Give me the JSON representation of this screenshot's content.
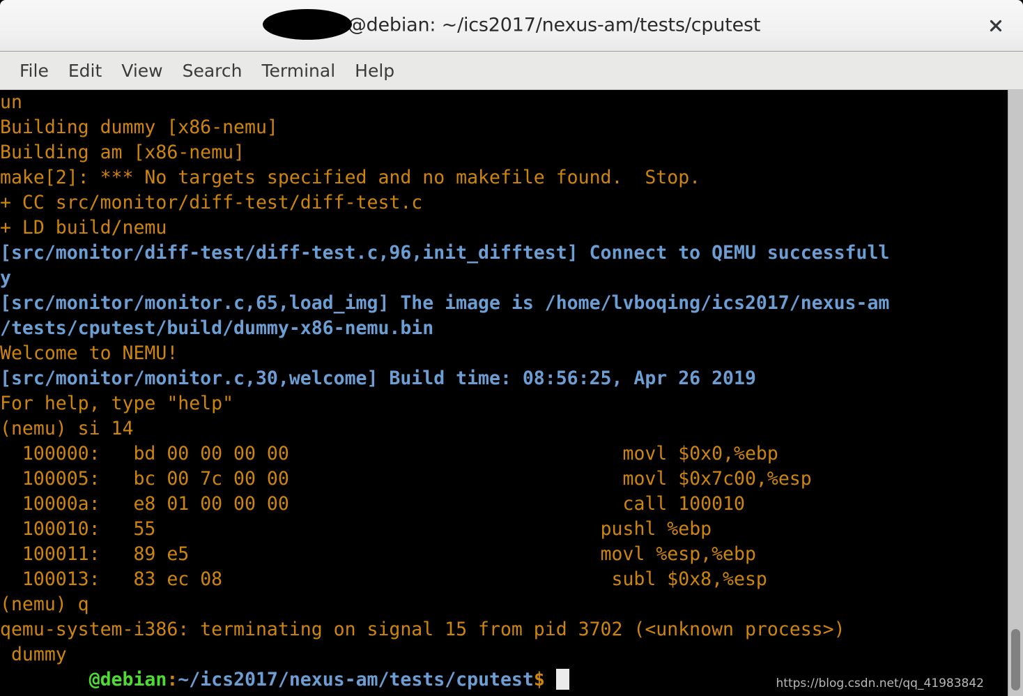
{
  "window": {
    "title": "@debian: ~/ics2017/nexus-am/tests/cputest",
    "close_label": "✕"
  },
  "menubar": {
    "items": [
      {
        "label": "File"
      },
      {
        "label": "Edit"
      },
      {
        "label": "View"
      },
      {
        "label": "Search"
      },
      {
        "label": "Terminal"
      },
      {
        "label": "Help"
      }
    ]
  },
  "colors": {
    "background": "#000000",
    "orange": "#cd850b",
    "blue": "#6c9ed4",
    "green": "#4fdb33",
    "titlebar": "#f2f2f2",
    "menubar": "#e9e9e7",
    "scrollbar_track": "#c6c6c6",
    "scrollbar_thumb": "#818181",
    "cursor": "#ebebeb"
  },
  "terminal": {
    "lines": [
      "un",
      "Building dummy [x86-nemu]",
      "Building am [x86-nemu]",
      "make[2]: *** No targets specified and no makefile found.  Stop.",
      "+ CC src/monitor/diff-test/diff-test.c",
      "+ LD build/nemu"
    ],
    "log_line_1": "[src/monitor/diff-test/diff-test.c,96,init_difftest] Connect to QEMU successfull",
    "log_line_1_wrap": "y",
    "log_line_2": "[src/monitor/monitor.c,65,load_img] The image is /home/lvboqing/ics2017/nexus-am",
    "log_line_2_wrap": "/tests/cputest/build/dummy-x86-nemu.bin",
    "welcome": "Welcome to NEMU!",
    "log_line_3": "[src/monitor/monitor.c,30,welcome] Build time: 08:56:25, Apr 26 2019",
    "help_hint": "For help, type \"help\"",
    "command_si": "(nemu) si 14",
    "disassembly": [
      {
        "address": "  100000:",
        "bytes": "bd 00 00 00 00",
        "mnemonic": "movl $0x0,%ebp"
      },
      {
        "address": "  100005:",
        "bytes": "bc 00 7c 00 00",
        "mnemonic": "movl $0x7c00,%esp"
      },
      {
        "address": "  10000a:",
        "bytes": "e8 01 00 00 00",
        "mnemonic": "call 100010"
      },
      {
        "address": "  100010:",
        "bytes": "55",
        "mnemonic": "pushl %ebp"
      },
      {
        "address": "  100011:",
        "bytes": "89 e5",
        "mnemonic": "movl %esp,%ebp"
      },
      {
        "address": "  100013:",
        "bytes": "83 ec 08",
        "mnemonic": "subl $0x8,%esp"
      }
    ],
    "command_q": "(nemu) q",
    "qemu_terminating": "qemu-system-i386: terminating on signal 15 from pid 3702 (<unknown process>)",
    "dummy_line": " dummy",
    "prompt": {
      "user_redacted": "        ",
      "host": "@debian",
      "separator": ":",
      "path": "~/ics2017/nexus-am/tests/cputest",
      "symbol": "$"
    }
  },
  "watermark": {
    "text": "https://blog.csdn.net/qq_41983842"
  }
}
